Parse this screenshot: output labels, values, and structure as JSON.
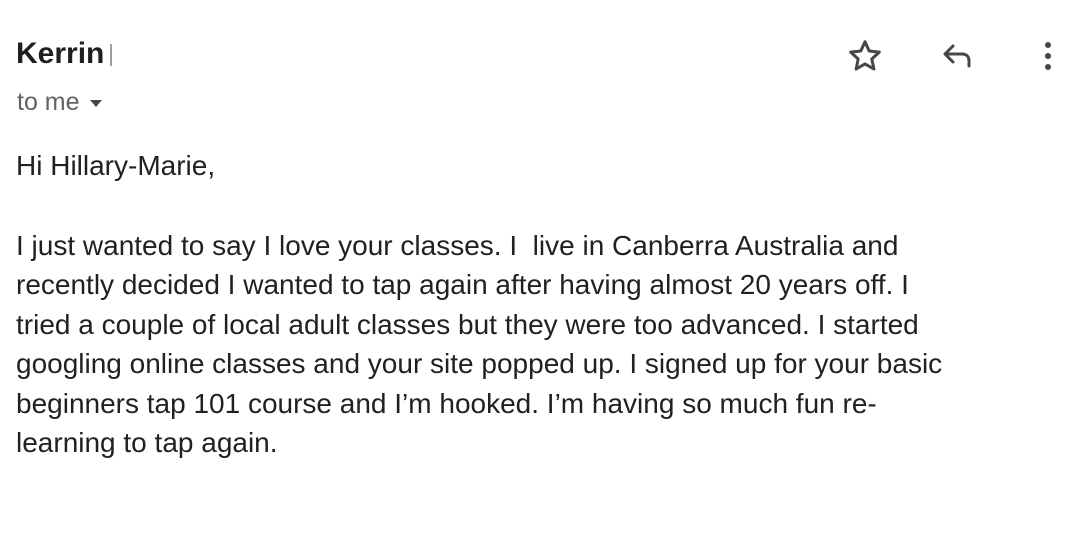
{
  "email": {
    "sender": "Kerrin",
    "recipient": "to me",
    "greeting": "Hi Hillary-Marie,",
    "body_lines": [
      "I just wanted to say I love your classes. I  live in Canberra Australia and",
      "recently decided I wanted to tap again after having almost 20 years off. I",
      "tried a couple of local adult classes but they were too advanced. I started",
      "googling online classes and your site popped up. I signed up for your basic",
      "beginners tap 101 course and I’m hooked. I’m having so much fun re-",
      "learning to tap again."
    ]
  },
  "actions": {
    "star_icon": "star-outline-icon",
    "reply_icon": "reply-arrow-icon",
    "more_icon": "more-vertical-icon"
  },
  "colors": {
    "text": "#202124",
    "secondary_text": "#5f6368",
    "icon": "#444746"
  }
}
